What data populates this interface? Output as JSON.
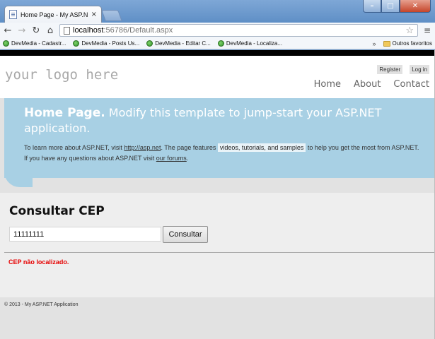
{
  "browser": {
    "tab_title": "Home Page - My ASP.NET",
    "tab_close": "×",
    "url_host": "localhost",
    "url_rest": ":56786/Default.aspx",
    "bookmarks": [
      "DevMedia - Cadastr...",
      "DevMedia - Posts Us...",
      "DevMedia - Editar C...",
      "DevMedia - Localiza..."
    ],
    "bookmarks_more": "»",
    "other_bookmarks": "Outros favoritos"
  },
  "header": {
    "logo": "your logo here",
    "register": "Register",
    "login": "Log in",
    "menu": [
      "Home",
      "About",
      "Contact"
    ]
  },
  "featured": {
    "title_strong": "Home Page.",
    "title_text": " Modify this template to jump-start your ASP.NET application.",
    "intro_1": "To learn more about ASP.NET, visit ",
    "link_asp": "http://asp.net",
    "intro_2": ". The page features ",
    "highlight": "videos, tutorials, and samples",
    "intro_3": " to help you get the most from ASP.NET. If you have any questions about ASP.NET visit ",
    "link_forums": "our forums",
    "intro_4": "."
  },
  "main": {
    "title": "Consultar CEP",
    "cep_value": "11111111",
    "button_label": "Consultar",
    "error": "CEP não localizado."
  },
  "footer": {
    "text": "© 2013 - My ASP.NET Application"
  }
}
